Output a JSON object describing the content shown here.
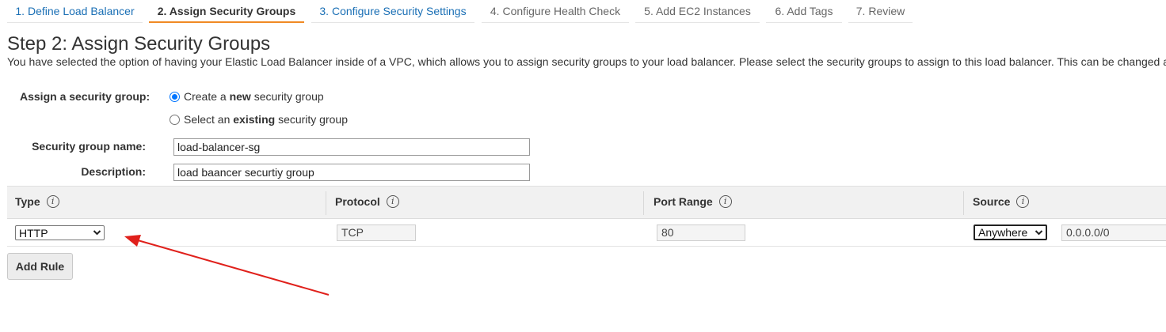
{
  "wizard": {
    "tabs": [
      {
        "label": "1. Define Load Balancer"
      },
      {
        "label": "2. Assign Security Groups"
      },
      {
        "label": "3. Configure Security Settings"
      },
      {
        "label": "4. Configure Health Check"
      },
      {
        "label": "5. Add EC2 Instances"
      },
      {
        "label": "6. Add Tags"
      },
      {
        "label": "7. Review"
      }
    ],
    "active_index": 1
  },
  "page": {
    "title": "Step 2: Assign Security Groups",
    "description": "You have selected the option of having your Elastic Load Balancer inside of a VPC, which allows you to assign security groups to your load balancer. Please select the security groups to assign to this load balancer. This can be changed at any time."
  },
  "form": {
    "assign_label": "Assign a security group:",
    "options": [
      {
        "pre": "Create a ",
        "bold": "new",
        "post": " security group",
        "selected": true
      },
      {
        "pre": "Select an ",
        "bold": "existing",
        "post": " security group",
        "selected": false
      }
    ],
    "name_label": "Security group name:",
    "name_value": "load-balancer-sg",
    "description_label": "Description:",
    "description_value": "load baancer securtiy group"
  },
  "rules": {
    "headers": {
      "type": "Type",
      "protocol": "Protocol",
      "port_range": "Port Range",
      "source": "Source"
    },
    "rows": [
      {
        "type": "HTTP",
        "protocol": "TCP",
        "port_range": "80",
        "source": "Anywhere",
        "cidr": "0.0.0.0/0"
      }
    ],
    "add_rule_label": "Add Rule"
  },
  "icons": {
    "info": "info-icon",
    "dropdown": "chevron-down-icon",
    "annotation": "red-arrow"
  },
  "colors": {
    "link": "#1a6fb5",
    "active_tab_underline": "#f08a24",
    "arrow": "#e0201b",
    "radio": "#0075ff"
  }
}
